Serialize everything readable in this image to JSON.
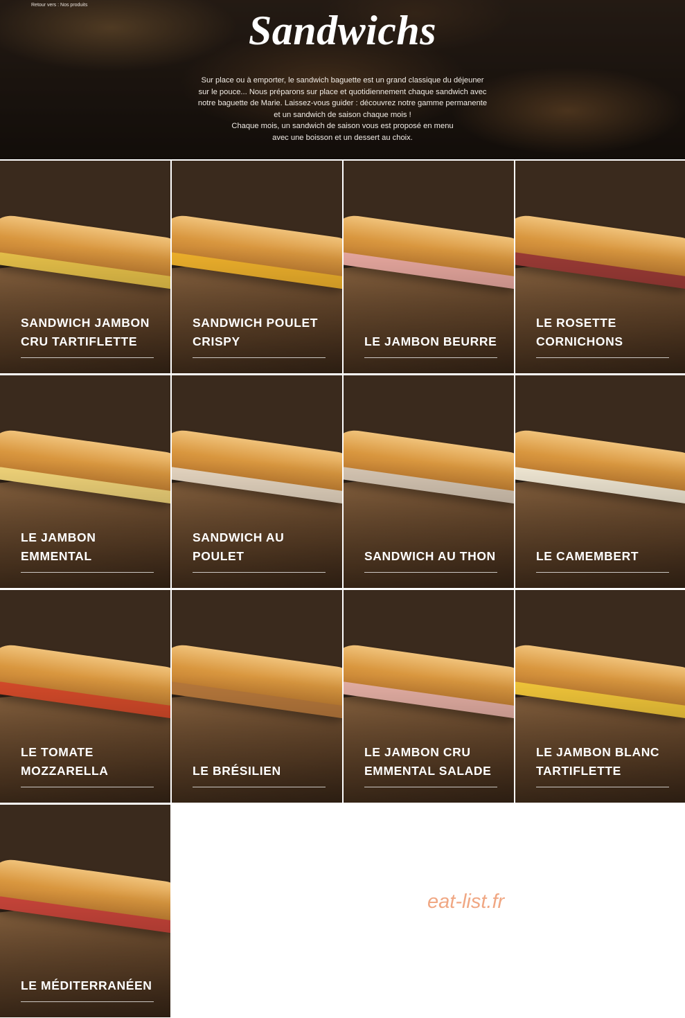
{
  "breadcrumb": {
    "prefix": "Retour vers :",
    "link": "Nos produits"
  },
  "hero": {
    "title": "Sandwichs",
    "lines": [
      "Sur place ou à emporter, le sandwich baguette est un grand classique du déjeuner",
      "sur le pouce... Nous préparons sur place et quotidiennement chaque sandwich avec",
      "notre baguette de Marie. Laissez-vous guider : découvrez notre gamme permanente",
      "et un sandwich de saison chaque mois !",
      "Chaque mois, un sandwich de saison vous est proposé en menu",
      "avec une boisson et un dessert au choix."
    ]
  },
  "products": [
    {
      "name": "Sandwich Jambon cru tartiflette",
      "filling": "#e8c24a"
    },
    {
      "name": "Sandwich poulet crispy",
      "filling": "#f0b22c"
    },
    {
      "name": "Le jambon beurre",
      "filling": "#e9a9a0"
    },
    {
      "name": "Le rosette cornichons",
      "filling": "#9c3b36"
    },
    {
      "name": "Le jambon emmental",
      "filling": "#f2d57a"
    },
    {
      "name": "Sandwich au poulet",
      "filling": "#e7d7c2"
    },
    {
      "name": "Sandwich au thon",
      "filling": "#d8c8b5"
    },
    {
      "name": "Le camembert",
      "filling": "#f3ead6"
    },
    {
      "name": "Le tomate mozzarella",
      "filling": "#d64b2a"
    },
    {
      "name": "Le brésilien",
      "filling": "#b8793c"
    },
    {
      "name": "Le jambon cru emmental salade",
      "filling": "#e6b0a5"
    },
    {
      "name": "Le jambon blanc tartiflette",
      "filling": "#f4c83a"
    },
    {
      "name": "Le méditerranéen",
      "filling": "#c9453a"
    }
  ],
  "watermark": "eat-list.fr"
}
